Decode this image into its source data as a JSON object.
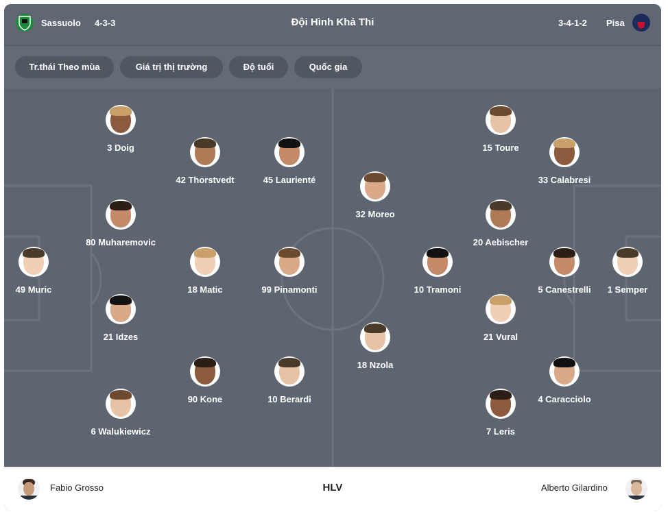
{
  "header": {
    "title": "Đội Hình Khả Thi",
    "home": {
      "name": "Sassuolo",
      "formation": "4-3-3",
      "logo_icon": "sassuolo-crest-icon",
      "color": "#1b8a3a"
    },
    "away": {
      "name": "Pisa",
      "formation": "3-4-1-2",
      "logo_icon": "pisa-crest-icon",
      "color": "#1c2b5a"
    }
  },
  "filters": [
    "Tr.thái Theo mùa",
    "Giá trị thị trường",
    "Độ tuổi",
    "Quốc gia"
  ],
  "home_players": [
    {
      "label": "49 Muric"
    },
    {
      "label": "3 Doig"
    },
    {
      "label": "80 Muharemovic"
    },
    {
      "label": "21 Idzes"
    },
    {
      "label": "6 Walukiewicz"
    },
    {
      "label": "42 Thorstvedt"
    },
    {
      "label": "18 Matic"
    },
    {
      "label": "90 Kone"
    },
    {
      "label": "45 Laurienté"
    },
    {
      "label": "99 Pinamonti"
    },
    {
      "label": "10 Berardi"
    }
  ],
  "away_players": [
    {
      "label": "1 Semper"
    },
    {
      "label": "33 Calabresi"
    },
    {
      "label": "5 Canestrelli"
    },
    {
      "label": "4 Caracciolo"
    },
    {
      "label": "15 Toure"
    },
    {
      "label": "20 Aebischer"
    },
    {
      "label": "21 Vural"
    },
    {
      "label": "7 Leris"
    },
    {
      "label": "10 Tramoni"
    },
    {
      "label": "32 Moreo"
    },
    {
      "label": "18 Nzola"
    }
  ],
  "coaches": {
    "label": "HLV",
    "home": "Fabio Grosso",
    "away": "Alberto Gilardino"
  },
  "colors": {
    "pitch": "#5c6570",
    "header": "#5e6772",
    "chip": "#4f5761",
    "line": "#6b747e"
  }
}
